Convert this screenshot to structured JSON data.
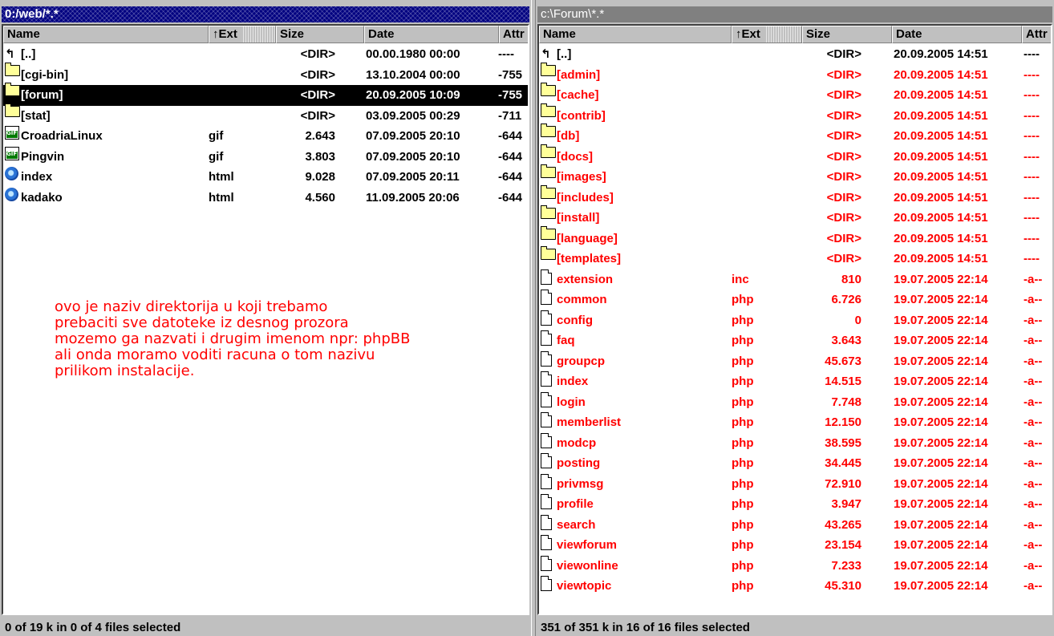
{
  "left_panel": {
    "path": "0:/web/*.*",
    "columns": {
      "name": "Name",
      "ext": "↑Ext",
      "size": "Size",
      "date": "Date",
      "attr": "Attr"
    },
    "rows": [
      {
        "icon": "up-directory-icon",
        "name": "[..]",
        "ext": "",
        "size": "<DIR>",
        "date": "00.00.1980 00:00",
        "attr": "----"
      },
      {
        "icon": "folder-icon",
        "name": "[cgi-bin]",
        "ext": "",
        "size": "<DIR>",
        "date": "13.10.2004 00:00",
        "attr": "-755"
      },
      {
        "icon": "folder-icon",
        "name": "[forum]",
        "ext": "",
        "size": "<DIR>",
        "date": "20.09.2005 10:09",
        "attr": "-755",
        "selected": true
      },
      {
        "icon": "folder-icon",
        "name": "[stat]",
        "ext": "",
        "size": "<DIR>",
        "date": "03.09.2005 00:29",
        "attr": "-711"
      },
      {
        "icon": "gif-file-icon",
        "name": "CroadriaLinux",
        "ext": "gif",
        "size": "2.643",
        "date": "07.09.2005 20:10",
        "attr": "-644"
      },
      {
        "icon": "gif-file-icon",
        "name": "Pingvin",
        "ext": "gif",
        "size": "3.803",
        "date": "07.09.2005 20:10",
        "attr": "-644"
      },
      {
        "icon": "html-file-icon",
        "name": "index",
        "ext": "html",
        "size": "9.028",
        "date": "07.09.2005 20:11",
        "attr": "-644"
      },
      {
        "icon": "html-file-icon",
        "name": "kadako",
        "ext": "html",
        "size": "4.560",
        "date": "11.09.2005 20:06",
        "attr": "-644"
      }
    ],
    "status": "0 of 19 k in 0 of 4 files selected"
  },
  "annotation": {
    "lines": [
      "ovo je naziv direktorija u koji trebamo",
      "prebaciti sve datoteke iz desnog prozora",
      "mozemo ga  nazvati i drugim imenom npr: phpBB",
      "ali onda moramo voditi racuna o tom nazivu",
      "prilikom instalacije."
    ]
  },
  "right_panel": {
    "path": "c:\\Forum\\*.*",
    "columns": {
      "name": "Name",
      "ext": "↑Ext",
      "size": "Size",
      "date": "Date",
      "attr": "Attr"
    },
    "rows": [
      {
        "icon": "up-directory-icon",
        "name": "[..]",
        "ext": "",
        "size": "<DIR>",
        "date": "20.09.2005 14:51",
        "attr": "----"
      },
      {
        "icon": "folder-icon",
        "name": "[admin]",
        "ext": "",
        "size": "<DIR>",
        "date": "20.09.2005 14:51",
        "attr": "----",
        "marked": true
      },
      {
        "icon": "folder-icon",
        "name": "[cache]",
        "ext": "",
        "size": "<DIR>",
        "date": "20.09.2005 14:51",
        "attr": "----",
        "marked": true
      },
      {
        "icon": "folder-icon",
        "name": "[contrib]",
        "ext": "",
        "size": "<DIR>",
        "date": "20.09.2005 14:51",
        "attr": "----",
        "marked": true
      },
      {
        "icon": "folder-icon",
        "name": "[db]",
        "ext": "",
        "size": "<DIR>",
        "date": "20.09.2005 14:51",
        "attr": "----",
        "marked": true
      },
      {
        "icon": "folder-icon",
        "name": "[docs]",
        "ext": "",
        "size": "<DIR>",
        "date": "20.09.2005 14:51",
        "attr": "----",
        "marked": true
      },
      {
        "icon": "folder-icon",
        "name": "[images]",
        "ext": "",
        "size": "<DIR>",
        "date": "20.09.2005 14:51",
        "attr": "----",
        "marked": true
      },
      {
        "icon": "folder-icon",
        "name": "[includes]",
        "ext": "",
        "size": "<DIR>",
        "date": "20.09.2005 14:51",
        "attr": "----",
        "marked": true
      },
      {
        "icon": "folder-icon",
        "name": "[install]",
        "ext": "",
        "size": "<DIR>",
        "date": "20.09.2005 14:51",
        "attr": "----",
        "marked": true
      },
      {
        "icon": "folder-icon",
        "name": "[language]",
        "ext": "",
        "size": "<DIR>",
        "date": "20.09.2005 14:51",
        "attr": "----",
        "marked": true
      },
      {
        "icon": "folder-icon",
        "name": "[templates]",
        "ext": "",
        "size": "<DIR>",
        "date": "20.09.2005 14:51",
        "attr": "----",
        "marked": true
      },
      {
        "icon": "file-icon",
        "name": "extension",
        "ext": "inc",
        "size": "810",
        "date": "19.07.2005 22:14",
        "attr": "-a--",
        "marked": true
      },
      {
        "icon": "file-icon",
        "name": "common",
        "ext": "php",
        "size": "6.726",
        "date": "19.07.2005 22:14",
        "attr": "-a--",
        "marked": true
      },
      {
        "icon": "file-icon",
        "name": "config",
        "ext": "php",
        "size": "0",
        "date": "19.07.2005 22:14",
        "attr": "-a--",
        "marked": true
      },
      {
        "icon": "file-icon",
        "name": "faq",
        "ext": "php",
        "size": "3.643",
        "date": "19.07.2005 22:14",
        "attr": "-a--",
        "marked": true
      },
      {
        "icon": "file-icon",
        "name": "groupcp",
        "ext": "php",
        "size": "45.673",
        "date": "19.07.2005 22:14",
        "attr": "-a--",
        "marked": true
      },
      {
        "icon": "file-icon",
        "name": "index",
        "ext": "php",
        "size": "14.515",
        "date": "19.07.2005 22:14",
        "attr": "-a--",
        "marked": true
      },
      {
        "icon": "file-icon",
        "name": "login",
        "ext": "php",
        "size": "7.748",
        "date": "19.07.2005 22:14",
        "attr": "-a--",
        "marked": true
      },
      {
        "icon": "file-icon",
        "name": "memberlist",
        "ext": "php",
        "size": "12.150",
        "date": "19.07.2005 22:14",
        "attr": "-a--",
        "marked": true
      },
      {
        "icon": "file-icon",
        "name": "modcp",
        "ext": "php",
        "size": "38.595",
        "date": "19.07.2005 22:14",
        "attr": "-a--",
        "marked": true
      },
      {
        "icon": "file-icon",
        "name": "posting",
        "ext": "php",
        "size": "34.445",
        "date": "19.07.2005 22:14",
        "attr": "-a--",
        "marked": true
      },
      {
        "icon": "file-icon",
        "name": "privmsg",
        "ext": "php",
        "size": "72.910",
        "date": "19.07.2005 22:14",
        "attr": "-a--",
        "marked": true
      },
      {
        "icon": "file-icon",
        "name": "profile",
        "ext": "php",
        "size": "3.947",
        "date": "19.07.2005 22:14",
        "attr": "-a--",
        "marked": true
      },
      {
        "icon": "file-icon",
        "name": "search",
        "ext": "php",
        "size": "43.265",
        "date": "19.07.2005 22:14",
        "attr": "-a--",
        "marked": true
      },
      {
        "icon": "file-icon",
        "name": "viewforum",
        "ext": "php",
        "size": "23.154",
        "date": "19.07.2005 22:14",
        "attr": "-a--",
        "marked": true
      },
      {
        "icon": "file-icon",
        "name": "viewonline",
        "ext": "php",
        "size": "7.233",
        "date": "19.07.2005 22:14",
        "attr": "-a--",
        "marked": true
      },
      {
        "icon": "file-icon",
        "name": "viewtopic",
        "ext": "php",
        "size": "45.310",
        "date": "19.07.2005 22:14",
        "attr": "-a--",
        "marked": true
      }
    ],
    "status": "351 of 351 k in 16 of 16 files selected"
  },
  "colors": {
    "active_title": "#000080",
    "inactive_title": "#808080",
    "marked_text": "#ff0000",
    "selected_row_bg": "#000000",
    "annotation_text": "#ff0000"
  }
}
